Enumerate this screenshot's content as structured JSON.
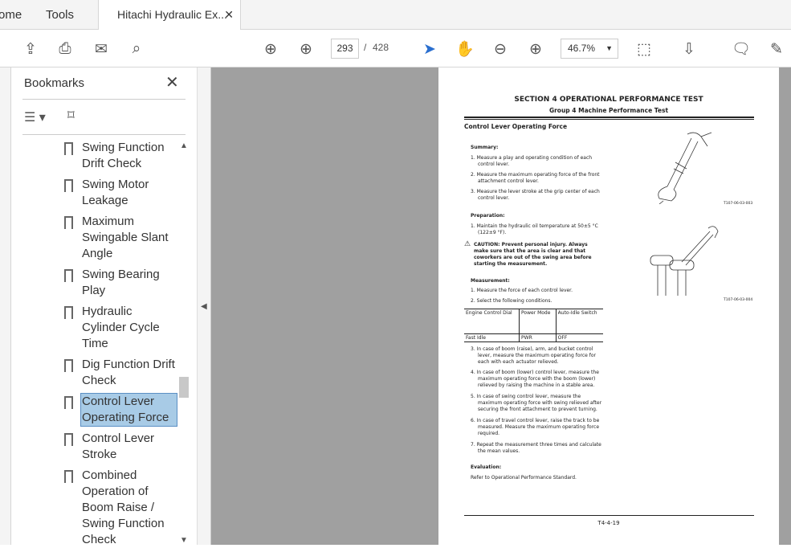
{
  "tabs": [
    {
      "label": "ome"
    },
    {
      "label": "Tools"
    },
    {
      "label": "Hitachi Hydraulic Ex..."
    }
  ],
  "toolbar": {
    "page_current": "293",
    "page_sep": "/",
    "page_total": "428",
    "zoom": "46.7%"
  },
  "bookmarks": {
    "title": "Bookmarks",
    "items": [
      {
        "label": "Swing Function Drift Check"
      },
      {
        "label": "Swing Motor Leakage"
      },
      {
        "label": "Maximum Swingable Slant Angle"
      },
      {
        "label": "Swing Bearing Play"
      },
      {
        "label": "Hydraulic Cylinder Cycle Time"
      },
      {
        "label": "Dig Function Drift Check"
      },
      {
        "label": "Control Lever Operating Force"
      },
      {
        "label": "Control Lever Stroke"
      },
      {
        "label": "Combined Operation of Boom Raise / Swing Function Check"
      }
    ]
  },
  "document": {
    "section": "SECTION 4 OPERATIONAL PERFORMANCE TEST",
    "group": "Group 4 Machine Performance Test",
    "heading": "Control Lever Operating Force",
    "summary_title": "Summary:",
    "summary": [
      "1.  Measure a play and operating condition of each control lever.",
      "2.  Measure the maximum operating force of the front attachment control lever.",
      "3.  Measure the lever stroke at the grip center of each control lever."
    ],
    "prep_title": "Preparation:",
    "prep": [
      "1.  Maintain the hydraulic oil temperature at 50±5 °C (122±9 °F)."
    ],
    "caution": "CAUTION:   Prevent personal injury. Always make sure that the area is clear and that coworkers are out of the swing area before starting the measurement.",
    "meas_title": "Measurement:",
    "meas_a": [
      "1.  Measure the force of each control lever.",
      "2.  Select the following conditions."
    ],
    "table": {
      "headers": [
        "Engine Control Dial",
        "Power Mode",
        "Auto-Idle Switch"
      ],
      "row": [
        "Fast Idle",
        "PWR",
        "OFF"
      ]
    },
    "meas_b": [
      "3.  In case of boom (raise), arm, and bucket control lever, measure the maximum operating force for each with each actuator relieved.",
      "4.  In case of boom (lower) control lever, measure the maximum operating force with the boom (lower) relieved by raising the machine in a stable area.",
      "5.  In case of swing control lever, measure the maximum operating force with swing relieved after securing the front attachment to prevent turning.",
      "6.  In case of travel control lever, raise the track to be measured. Measure the maximum operating force required.",
      "7.  Repeat the measurement three times and calculate the mean values."
    ],
    "eval_title": "Evaluation:",
    "eval": "Refer to Operational Performance Standard.",
    "fig1": "T107-06-03-003",
    "fig2": "T107-06-03-004",
    "footer": "T4-4-19"
  }
}
